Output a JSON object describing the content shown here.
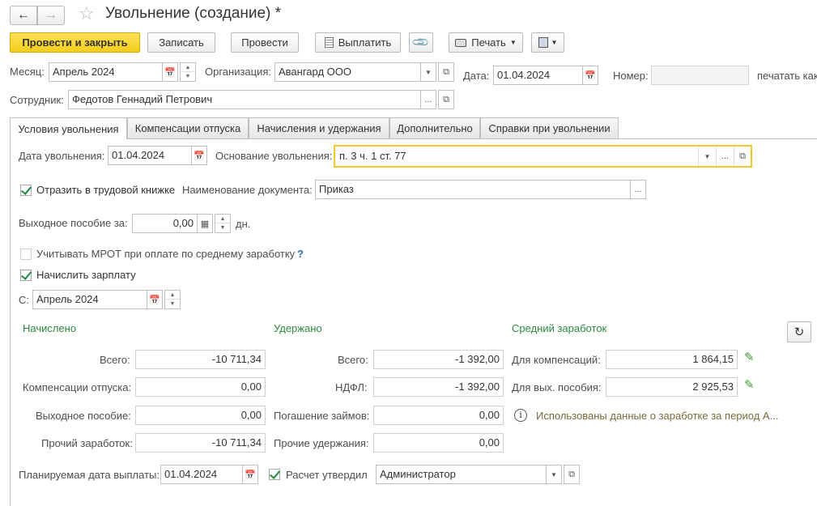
{
  "title": "Увольнение (создание) *",
  "toolbar": {
    "post_close": "Провести и закрыть",
    "save": "Записать",
    "post": "Провести",
    "pay": "Выплатить",
    "print": "Печать"
  },
  "header": {
    "month_label": "Месяц:",
    "month_value": "Апрель 2024",
    "org_label": "Организация:",
    "org_value": "Авангард ООО",
    "date_label": "Дата:",
    "date_value": "01.04.2024",
    "number_label": "Номер:",
    "number_value": "",
    "print_as_label": "печатать как",
    "employee_label": "Сотрудник:",
    "employee_value": "Федотов Геннадий Петрович"
  },
  "tabs": [
    {
      "label": "Условия увольнения",
      "active": true
    },
    {
      "label": "Компенсации отпуска",
      "active": false
    },
    {
      "label": "Начисления и удержания",
      "active": false
    },
    {
      "label": "Дополнительно",
      "active": false
    },
    {
      "label": "Справки при увольнении",
      "active": false
    }
  ],
  "conditions": {
    "dismissal_date_label": "Дата увольнения:",
    "dismissal_date_value": "01.04.2024",
    "reason_label": "Основание увольнения:",
    "reason_value": "п. 3 ч. 1 ст. 77",
    "reflect_label": "Отразить в трудовой книжке",
    "reflect_checked": true,
    "doc_name_label": "Наименование документа:",
    "doc_name_value": "Приказ",
    "severance_label": "Выходное пособие за:",
    "severance_value": "0,00",
    "severance_unit": "дн.",
    "mrot_label": "Учитывать МРОТ при оплате по среднему заработку",
    "mrot_checked": false,
    "mrot_help": "?",
    "accrue_label": "Начислить зарплату",
    "accrue_checked": true,
    "from_label": "С:",
    "from_value": "Апрель 2024"
  },
  "accrued": {
    "header": "Начислено",
    "total_label": "Всего:",
    "total_value": "-10 711,34",
    "vacation_label": "Компенсации отпуска:",
    "vacation_value": "0,00",
    "severance_label": "Выходное пособие:",
    "severance_value": "0,00",
    "other_label": "Прочий заработок:",
    "other_value": "-10 711,34"
  },
  "withheld": {
    "header": "Удержано",
    "total_label": "Всего:",
    "total_value": "-1 392,00",
    "ndfl_label": "НДФЛ:",
    "ndfl_value": "-1 392,00",
    "loans_label": "Погашение займов:",
    "loans_value": "0,00",
    "other_label": "Прочие удержания:",
    "other_value": "0,00"
  },
  "average": {
    "header": "Средний заработок",
    "comp_label": "Для компенсаций:",
    "comp_value": "1 864,15",
    "sev_label": "Для вых. пособия:",
    "sev_value": "2 925,53",
    "info_text": "Использованы данные о заработке за период А..."
  },
  "footer": {
    "planned_date_label": "Планируемая дата выплаты:",
    "planned_date_value": "01.04.2024",
    "approved_label": "Расчет утвердил",
    "approved_checked": true,
    "approved_value": "Администратор"
  },
  "colors": {
    "primary_button": "#f4cd1a",
    "section_header": "#2b8a3e",
    "focus_border": "#f0c92a",
    "help_mark": "#2a6fb0"
  }
}
